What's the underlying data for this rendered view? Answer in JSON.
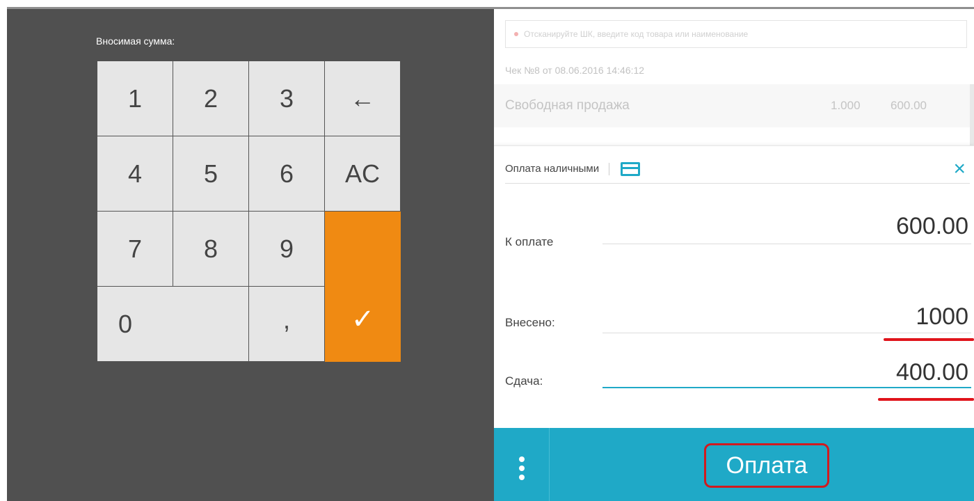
{
  "keypad": {
    "amount_label": "Вносимая сумма:",
    "keys": {
      "k1": "1",
      "k2": "2",
      "k3": "3",
      "backspace": "←",
      "k4": "4",
      "k5": "5",
      "k6": "6",
      "clear": "AC",
      "k7": "7",
      "k8": "8",
      "k9": "9",
      "k0": "0",
      "comma": ",",
      "confirm": "✓"
    },
    "accent_color": "#f08a12"
  },
  "receipt": {
    "search_placeholder": "Отсканируйте ШК, введите код товара или наименование",
    "title": "Чек №8 от 08.06.2016 14:46:12",
    "items": [
      {
        "name": "Свободная продажа",
        "qty": "1.000",
        "price": "600.00"
      }
    ]
  },
  "payment": {
    "tab_label": "Оплата наличными",
    "card_icon": "credit-card-icon",
    "close_icon": "×",
    "to_pay_label": "К оплате",
    "to_pay_value": "600.00",
    "paid_label": "Внесено:",
    "paid_value": "1000",
    "change_label": "Сдача:",
    "change_value": "400.00",
    "pay_button": "Оплата",
    "accent_color": "#1fa9c7"
  }
}
